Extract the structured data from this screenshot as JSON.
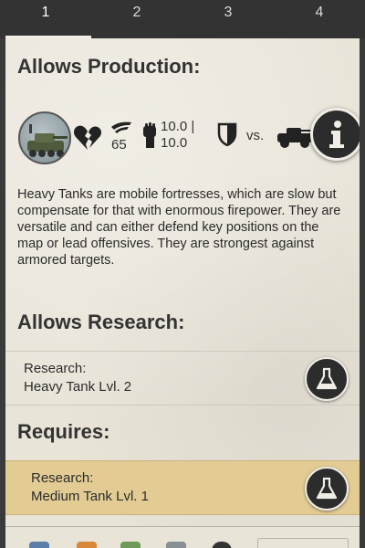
{
  "tabs": [
    {
      "label": "1",
      "active": true
    },
    {
      "label": "2",
      "active": false
    },
    {
      "label": "3",
      "active": false
    },
    {
      "label": "4",
      "active": false
    }
  ],
  "allows_production": {
    "heading": "Allows Production:",
    "unit_icon": "heavy-tank-portrait",
    "stats": {
      "health_icon": "broken-heart-icon",
      "speed_icon": "wing-speed-icon",
      "speed_value": "65",
      "attack_icon": "fist-icon",
      "attack_value_line1": "10.0 |",
      "attack_value_line2": "10.0",
      "defense_icon": "shield-icon",
      "vs_label": "vs.",
      "vs_target_icon": "armored-car-icon"
    },
    "info_icon": "info-icon",
    "description": "Heavy Tanks are mobile fortresses, which are slow but compensate for that with enormous firepower. They are versatile and can either defend key positions on the map or lead offensives. They are strongest against armored targets."
  },
  "allows_research": {
    "heading": "Allows Research:",
    "items": [
      {
        "label": "Research:",
        "value": "Heavy Tank Lvl. 2",
        "icon": "flask-icon"
      }
    ]
  },
  "requires": {
    "heading": "Requires:",
    "items": [
      {
        "label": "Research:",
        "value": "Medium Tank Lvl. 1",
        "icon": "flask-icon",
        "highlight": "#e3cc94"
      }
    ]
  },
  "bottom_bar": {
    "icons": [
      "book-icon",
      "barrel-icon",
      "money-icon",
      "vehicle-icon",
      "clock-icon"
    ]
  },
  "colors": {
    "panel_bg": "#e9e4d8",
    "tab_bar_bg": "#333333",
    "button_dark": "#2c2c2c",
    "requires_highlight": "#e3cc94"
  }
}
